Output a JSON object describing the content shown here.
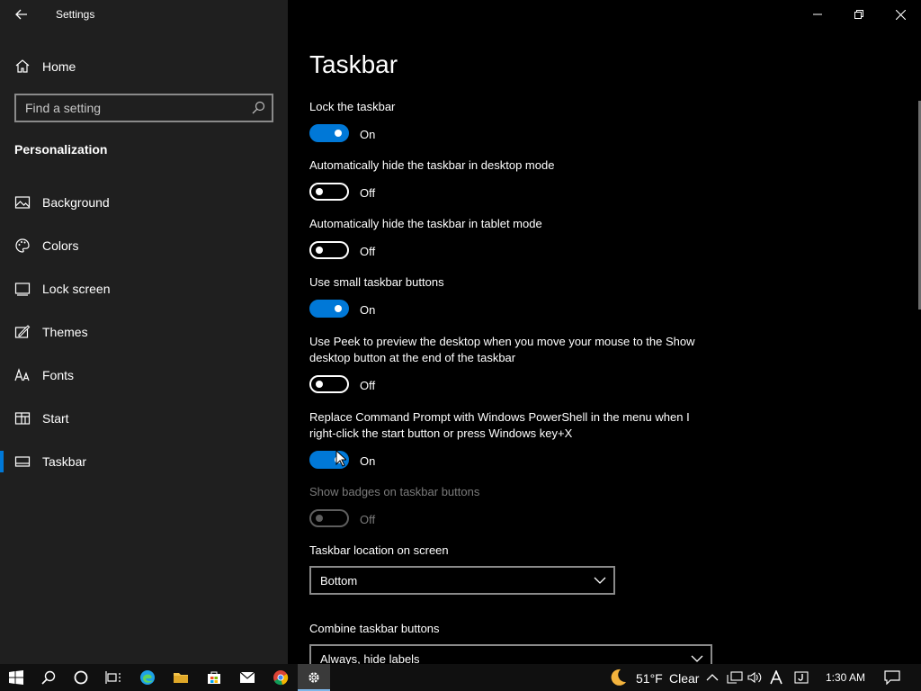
{
  "window": {
    "title": "Settings"
  },
  "sidebar": {
    "home_label": "Home",
    "search_placeholder": "Find a setting",
    "section_title": "Personalization",
    "items": [
      {
        "label": "Background",
        "icon": "picture-icon"
      },
      {
        "label": "Colors",
        "icon": "palette-icon"
      },
      {
        "label": "Lock screen",
        "icon": "lock-screen-icon"
      },
      {
        "label": "Themes",
        "icon": "themes-icon"
      },
      {
        "label": "Fonts",
        "icon": "fonts-icon"
      },
      {
        "label": "Start",
        "icon": "start-icon"
      },
      {
        "label": "Taskbar",
        "icon": "taskbar-icon",
        "selected": true
      }
    ]
  },
  "main": {
    "title": "Taskbar",
    "settings": [
      {
        "label": "Lock the taskbar",
        "state": "On"
      },
      {
        "label": "Automatically hide the taskbar in desktop mode",
        "state": "Off"
      },
      {
        "label": "Automatically hide the taskbar in tablet mode",
        "state": "Off"
      },
      {
        "label": "Use small taskbar buttons",
        "state": "On"
      },
      {
        "label": "Use Peek to preview the desktop when you move your mouse to the Show desktop button at the end of the taskbar",
        "state": "Off"
      },
      {
        "label": "Replace Command Prompt with Windows PowerShell in the menu when I right-click the start button or press Windows key+X",
        "state": "On"
      },
      {
        "label": "Show badges on taskbar buttons",
        "state": "Off",
        "disabled": true
      }
    ],
    "location_label": "Taskbar location on screen",
    "location_value": "Bottom",
    "combine_label": "Combine taskbar buttons",
    "combine_value": "Always, hide labels"
  },
  "taskbar": {
    "weather_temp": "51°F",
    "weather_desc": "Clear",
    "clock": "1:30 AM",
    "accent": "#0078d7"
  }
}
